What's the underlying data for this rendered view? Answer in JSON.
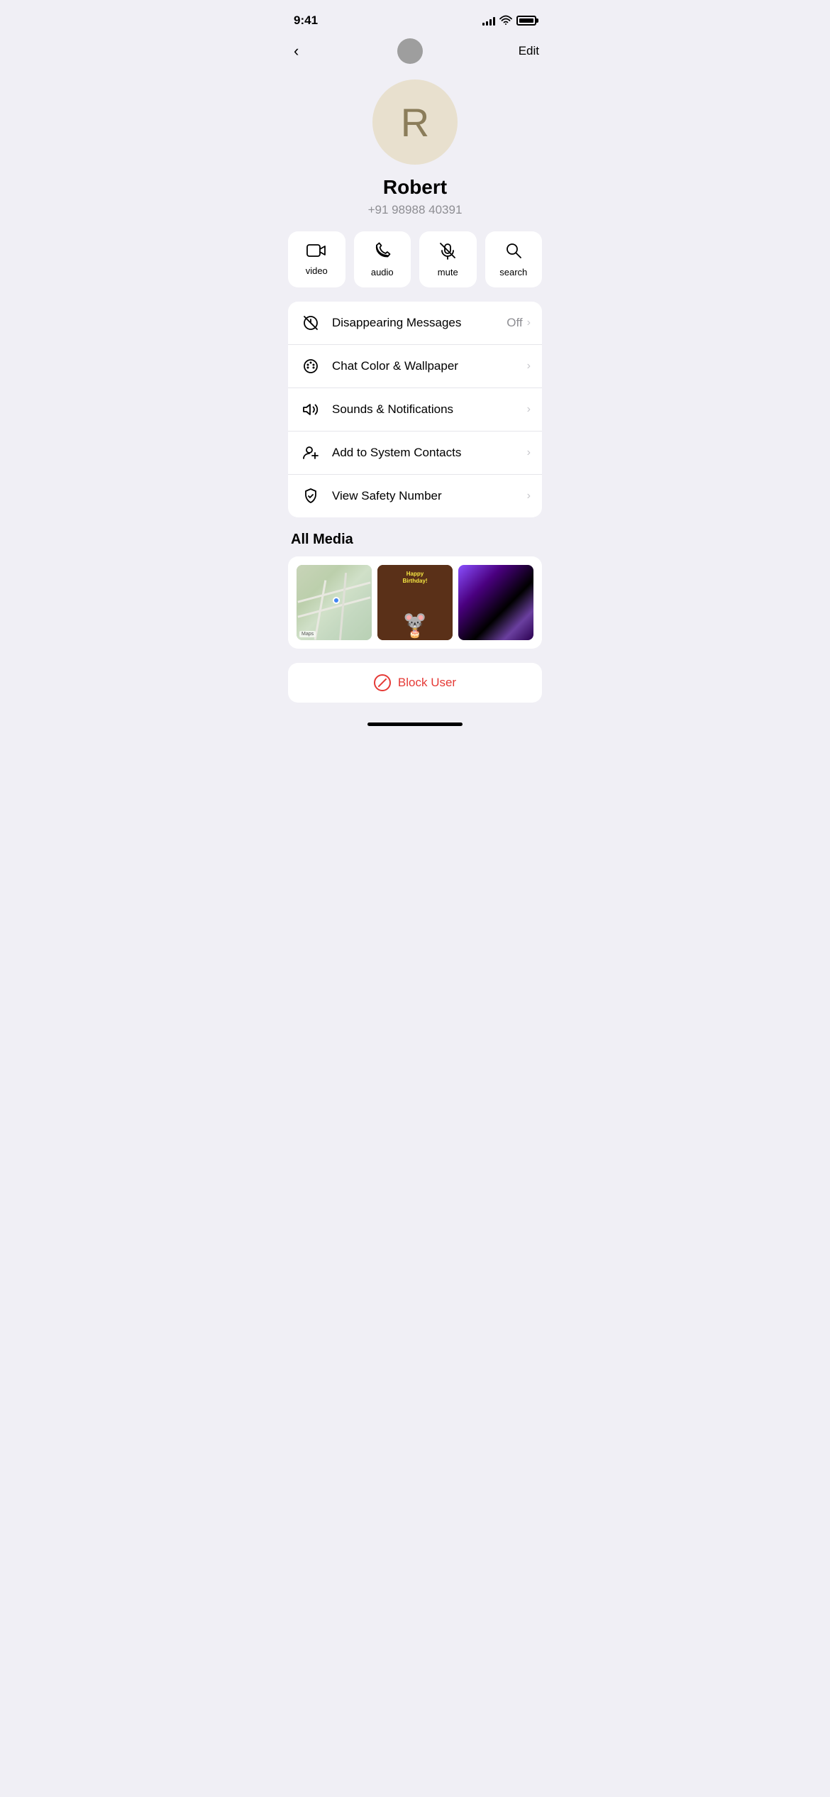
{
  "statusBar": {
    "time": "9:41",
    "battery": "full"
  },
  "nav": {
    "back_label": "<",
    "edit_label": "Edit"
  },
  "contact": {
    "initial": "R",
    "name": "Robert",
    "phone": "+91 98988 40391"
  },
  "actions": [
    {
      "id": "video",
      "label": "video"
    },
    {
      "id": "audio",
      "label": "audio"
    },
    {
      "id": "mute",
      "label": "mute"
    },
    {
      "id": "search",
      "label": "search"
    }
  ],
  "settings": [
    {
      "id": "disappearing",
      "label": "Disappearing Messages",
      "value": "Off",
      "hasChevron": true
    },
    {
      "id": "chatcolor",
      "label": "Chat Color & Wallpaper",
      "value": "",
      "hasChevron": true
    },
    {
      "id": "sounds",
      "label": "Sounds & Notifications",
      "value": "",
      "hasChevron": true
    },
    {
      "id": "addcontact",
      "label": "Add to System Contacts",
      "value": "",
      "hasChevron": true
    },
    {
      "id": "safetynumber",
      "label": "View Safety Number",
      "value": "",
      "hasChevron": true
    }
  ],
  "media": {
    "title": "All Media"
  },
  "blockUser": {
    "label": "Block User"
  }
}
